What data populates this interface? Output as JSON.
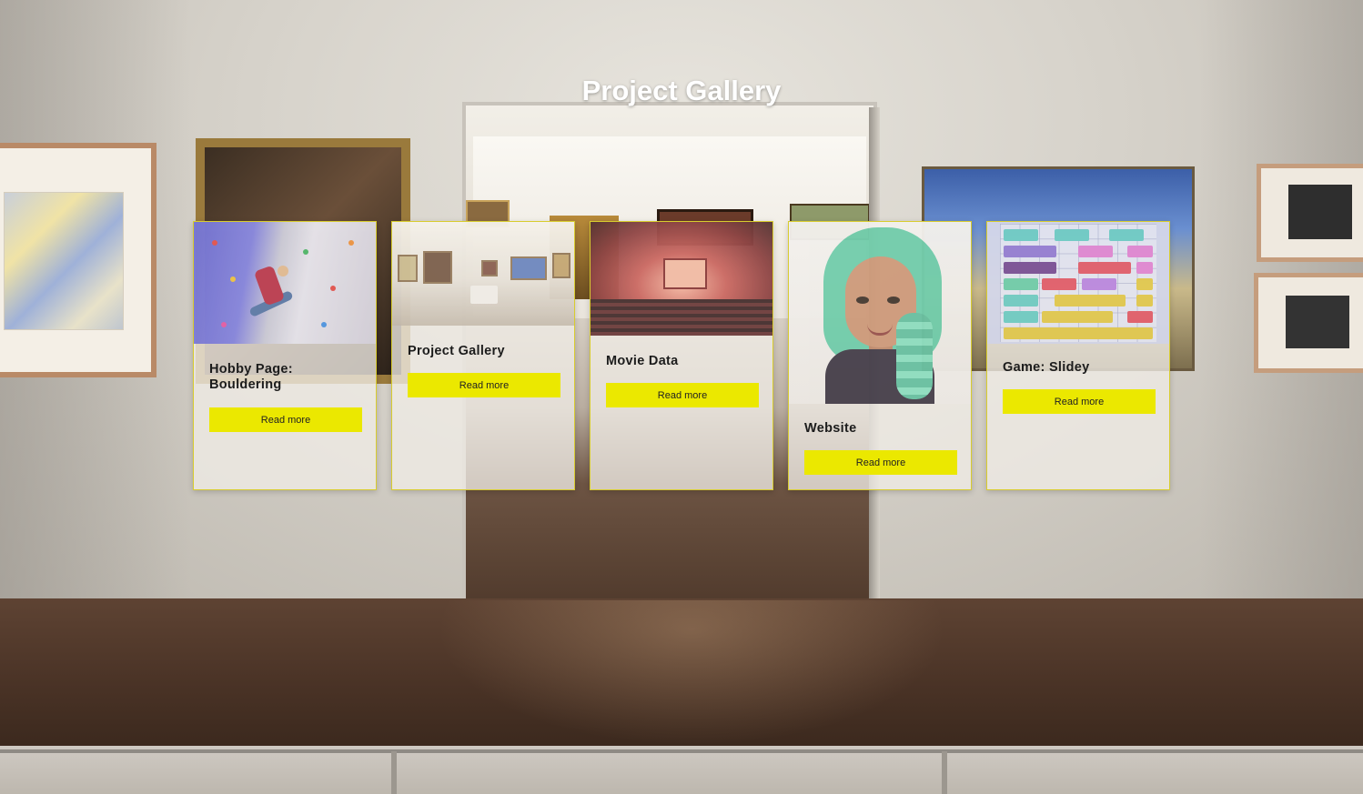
{
  "page": {
    "title": "Project Gallery"
  },
  "cards": [
    {
      "title": "Hobby Page: Bouldering",
      "image": "bouldering-climber-image",
      "button_label": "Read more"
    },
    {
      "title": "Project Gallery",
      "image": "art-gallery-room-image",
      "button_label": "Read more"
    },
    {
      "title": "Movie Data",
      "image": "cinema-theater-image",
      "button_label": "Read more"
    },
    {
      "title": "Website",
      "image": "green-haired-avatar-image",
      "button_label": "Read more"
    },
    {
      "title": "Game: Slidey",
      "image": "slidey-puzzle-board-image",
      "button_label": "Read more"
    }
  ],
  "colors": {
    "button_accent": "#ebe800",
    "card_border": "#d8cc2e",
    "title_text": "#ffffff"
  }
}
